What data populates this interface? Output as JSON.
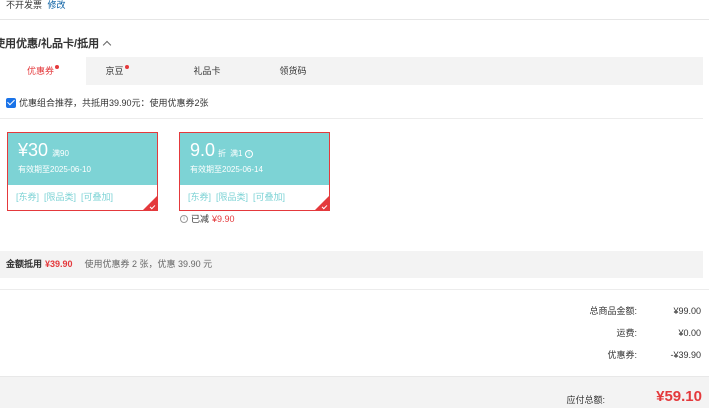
{
  "invoice": {
    "text": "不开发票",
    "edit": "修改"
  },
  "section": {
    "title": "使用优惠/礼品卡/抵用"
  },
  "tabs": [
    {
      "label": "优惠券",
      "active": true,
      "dot": true
    },
    {
      "label": "京豆",
      "active": false,
      "dot": true
    },
    {
      "label": "礼品卡",
      "active": false,
      "dot": false
    },
    {
      "label": "领货码",
      "active": false,
      "dot": false
    }
  ],
  "recommend": {
    "checked": true,
    "text": "优惠组合推荐，共抵用39.90元：使用优惠券2张"
  },
  "coupons": [
    {
      "amount": "¥30",
      "condition": "满90",
      "valid": "有效期至2025-06-10",
      "tags": [
        "[东券]",
        "[限品类]",
        "[可叠加]"
      ]
    },
    {
      "amount": "9.0",
      "unit": "折",
      "condition": "满1",
      "valid": "有效期至2025-06-14",
      "tags": [
        "[东券]",
        "[限品类]",
        "[可叠加]"
      ]
    }
  ],
  "coupon2_reduced": {
    "label": "已减",
    "value": "¥9.90"
  },
  "summary": {
    "label": "金额抵用",
    "amount": "¥39.90",
    "desc": "使用优惠券 2 张，优惠 39.90 元"
  },
  "totals": [
    {
      "label": "总商品金额:",
      "value": "¥99.00"
    },
    {
      "label": "运费:",
      "value": "¥0.00"
    },
    {
      "label": "优惠券:",
      "value": "-¥39.90"
    }
  ],
  "pay": {
    "label": "应付总额:",
    "value": "¥59.10"
  },
  "colors": {
    "accent": "#e4393c",
    "coupon_bg": "#7dd3d5",
    "link": "#005aa0"
  }
}
